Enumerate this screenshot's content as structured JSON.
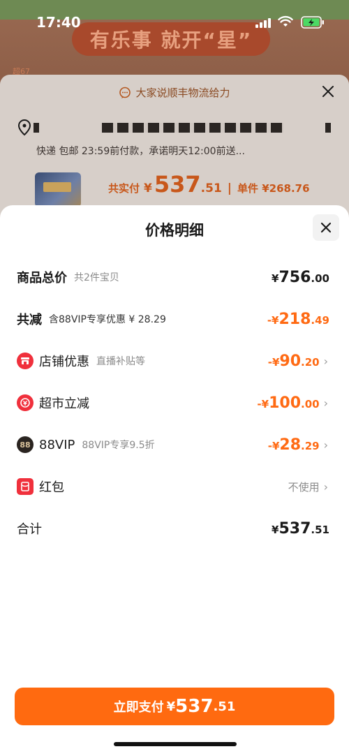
{
  "status_bar": {
    "time": "17:40"
  },
  "banner": {
    "headline": "有乐事 就开“星”",
    "tag": "超67"
  },
  "order_sheet": {
    "logistics_title": "大家说顺丰物流给力",
    "delivery_info": "快递 包邮 23:59前付款，承诺明天12:00前送...",
    "total_label": "共实付",
    "total_currency": "¥",
    "total_int": "537",
    "total_dec": ".51",
    "separator": "|",
    "unit_label": "单件 ¥268.76"
  },
  "price_detail": {
    "title": "价格明细",
    "rows": [
      {
        "title": "商品总价",
        "sub": "共2件宝贝",
        "currency": "¥",
        "int": "756",
        "dec": ".00"
      },
      {
        "title": "共减",
        "sub": "含88VIP专享优惠 ¥ 28.29",
        "currency": "-¥",
        "int": "218",
        "dec": ".49"
      },
      {
        "title": "店铺优惠",
        "sub": "直播补贴等",
        "currency": "-¥",
        "int": "90",
        "dec": ".20"
      },
      {
        "title": "超市立减",
        "sub": "",
        "currency": "-¥",
        "int": "100",
        "dec": ".00"
      },
      {
        "title": "88VIP",
        "sub": "88VIP专享9.5折",
        "currency": "-¥",
        "int": "28",
        "dec": ".29",
        "badge": "88"
      },
      {
        "title": "红包",
        "sub": "",
        "value": "不使用"
      },
      {
        "title": "合计",
        "sub": "",
        "currency": "¥",
        "int": "537",
        "dec": ".51"
      }
    ]
  },
  "pay_button": {
    "label": "立即支付",
    "currency": "¥",
    "int": "537",
    "dec": ".51"
  },
  "colors": {
    "accent": "#ff6a13",
    "brand_red": "#f0303c",
    "pay_button": "#ff6a10"
  },
  "icons": [
    "signal-icon",
    "wifi-icon",
    "battery-icon",
    "chat-icon",
    "close-icon",
    "location-icon",
    "store-icon",
    "coupon-icon",
    "vip-icon",
    "red-packet-icon",
    "chevron-right-icon"
  ]
}
